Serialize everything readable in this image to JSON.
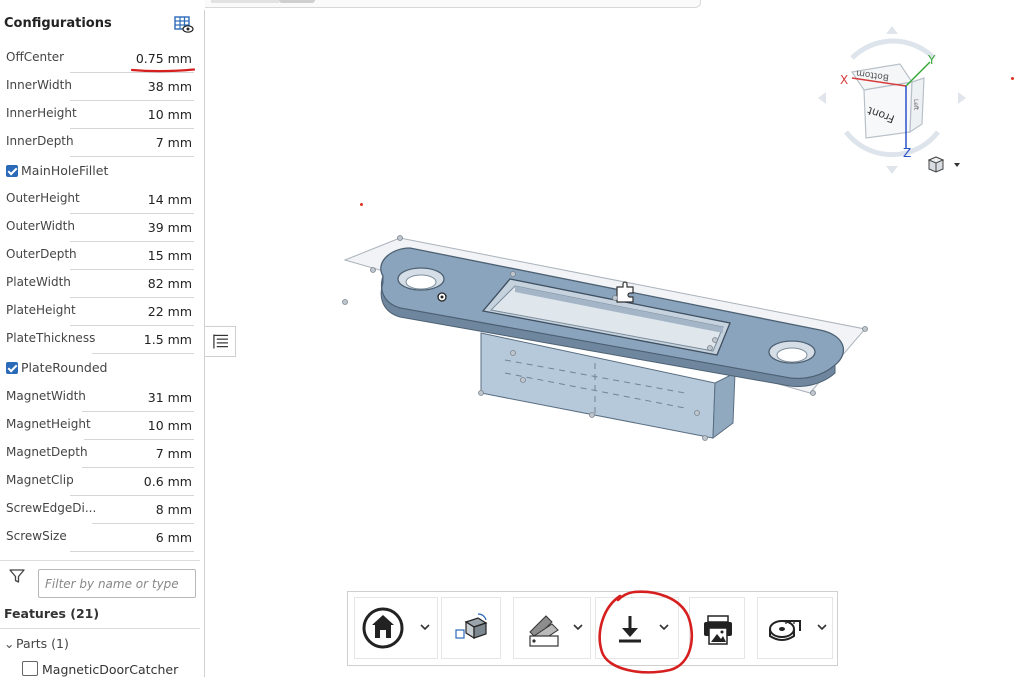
{
  "panel": {
    "title": "Configurations",
    "params": [
      {
        "name": "OffCenter",
        "value": "0.75 mm"
      },
      {
        "name": "InnerWidth",
        "value": "38 mm"
      },
      {
        "name": "InnerHeight",
        "value": "10 mm"
      },
      {
        "name": "InnerDepth",
        "value": "7 mm"
      },
      {
        "name": "OuterHeight",
        "value": "14 mm"
      },
      {
        "name": "OuterWidth",
        "value": "39 mm"
      },
      {
        "name": "OuterDepth",
        "value": "15 mm"
      },
      {
        "name": "PlateWidth",
        "value": "82 mm"
      },
      {
        "name": "PlateHeight",
        "value": "22 mm"
      },
      {
        "name": "PlateThickness",
        "value": "1.5 mm"
      },
      {
        "name": "MagnetWidth",
        "value": "31 mm"
      },
      {
        "name": "MagnetHeight",
        "value": "10 mm"
      },
      {
        "name": "MagnetDepth",
        "value": "7 mm"
      },
      {
        "name": "MagnetClip",
        "value": "0.6 mm"
      },
      {
        "name": "ScrewEdgeDi...",
        "value": "8 mm"
      },
      {
        "name": "ScrewSize",
        "value": "6 mm"
      }
    ],
    "checkboxes": [
      {
        "label": "MainHoleFillet",
        "checked": true
      },
      {
        "label": "PlateRounded",
        "checked": true
      }
    ],
    "filter_placeholder": "Filter by name or type",
    "features_label": "Features (21)",
    "parts_label": "Parts (1)",
    "part_name": "MagneticDoorCatcher"
  },
  "viewcube": {
    "faces": {
      "top": "Bottom",
      "front": "Front",
      "side": "Left"
    },
    "axes": {
      "x": "X",
      "y": "Y",
      "z": "Z"
    },
    "axis_colors": {
      "x": "#d83b3b",
      "y": "#3aa83a",
      "z": "#2a52c9"
    }
  },
  "toolbar": {
    "buttons": [
      "home-view",
      "named-views",
      "render-style",
      "export-download",
      "print-image",
      "measure"
    ]
  },
  "colors": {
    "accent": "#2a6ab8",
    "model_fill": "#8ba4bd",
    "annotation_red": "#d61f1f"
  }
}
